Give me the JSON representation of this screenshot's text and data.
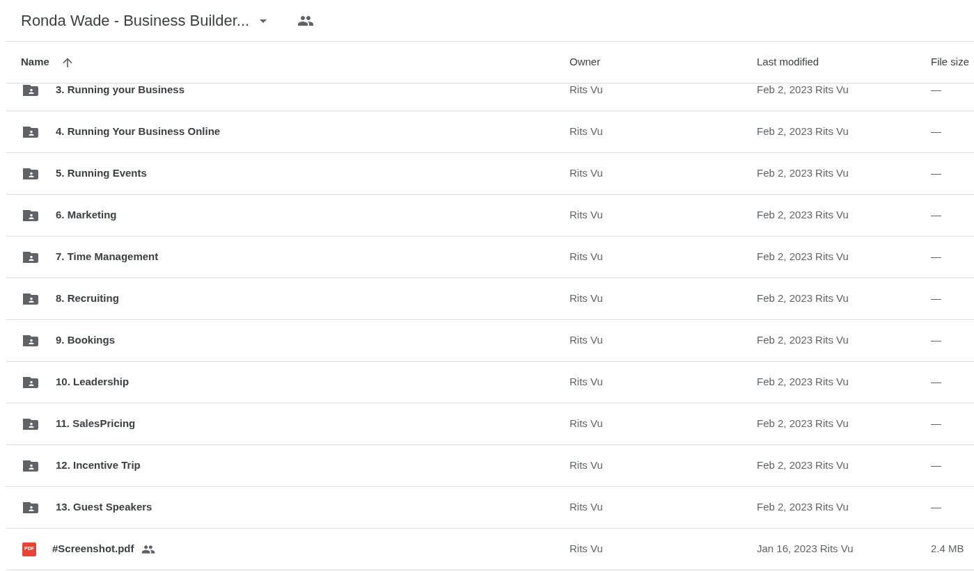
{
  "header": {
    "title": "Ronda Wade - Business Builder...",
    "shared": true
  },
  "table": {
    "columns": [
      {
        "label": "Name",
        "sorted": true
      },
      {
        "label": "Owner",
        "sorted": false
      },
      {
        "label": "Last modified",
        "sorted": false
      },
      {
        "label": "File size",
        "sorted": false
      }
    ],
    "rows": [
      {
        "kind": "folder",
        "name": "3. Running your Business",
        "shared": false,
        "owner": "Rits Vu",
        "modified_date": "Feb 2, 2023",
        "modified_by": "Rits Vu",
        "file_size": "—"
      },
      {
        "kind": "folder",
        "name": "4. Running Your Business Online",
        "shared": false,
        "owner": "Rits Vu",
        "modified_date": "Feb 2, 2023",
        "modified_by": "Rits Vu",
        "file_size": "—"
      },
      {
        "kind": "folder",
        "name": "5. Running Events",
        "shared": false,
        "owner": "Rits Vu",
        "modified_date": "Feb 2, 2023",
        "modified_by": "Rits Vu",
        "file_size": "—"
      },
      {
        "kind": "folder",
        "name": "6. Marketing",
        "shared": false,
        "owner": "Rits Vu",
        "modified_date": "Feb 2, 2023",
        "modified_by": "Rits Vu",
        "file_size": "—"
      },
      {
        "kind": "folder",
        "name": "7. Time Management",
        "shared": false,
        "owner": "Rits Vu",
        "modified_date": "Feb 2, 2023",
        "modified_by": "Rits Vu",
        "file_size": "—"
      },
      {
        "kind": "folder",
        "name": "8. Recruiting",
        "shared": false,
        "owner": "Rits Vu",
        "modified_date": "Feb 2, 2023",
        "modified_by": "Rits Vu",
        "file_size": "—"
      },
      {
        "kind": "folder",
        "name": "9. Bookings",
        "shared": false,
        "owner": "Rits Vu",
        "modified_date": "Feb 2, 2023",
        "modified_by": "Rits Vu",
        "file_size": "—"
      },
      {
        "kind": "folder",
        "name": "10. Leadership",
        "shared": false,
        "owner": "Rits Vu",
        "modified_date": "Feb 2, 2023",
        "modified_by": "Rits Vu",
        "file_size": "—"
      },
      {
        "kind": "folder",
        "name": "11. SalesPricing",
        "shared": false,
        "owner": "Rits Vu",
        "modified_date": "Feb 2, 2023",
        "modified_by": "Rits Vu",
        "file_size": "—"
      },
      {
        "kind": "folder",
        "name": "12. Incentive Trip",
        "shared": false,
        "owner": "Rits Vu",
        "modified_date": "Feb 2, 2023",
        "modified_by": "Rits Vu",
        "file_size": "—"
      },
      {
        "kind": "folder",
        "name": "13. Guest Speakers",
        "shared": false,
        "owner": "Rits Vu",
        "modified_date": "Feb 2, 2023",
        "modified_by": "Rits Vu",
        "file_size": "—"
      },
      {
        "kind": "pdf",
        "icon_label": "PDF",
        "name": "#Screenshot.pdf",
        "shared": true,
        "owner": "Rits Vu",
        "modified_date": "Jan 16, 2023",
        "modified_by": "Rits Vu",
        "file_size": "2.4 MB"
      }
    ]
  }
}
